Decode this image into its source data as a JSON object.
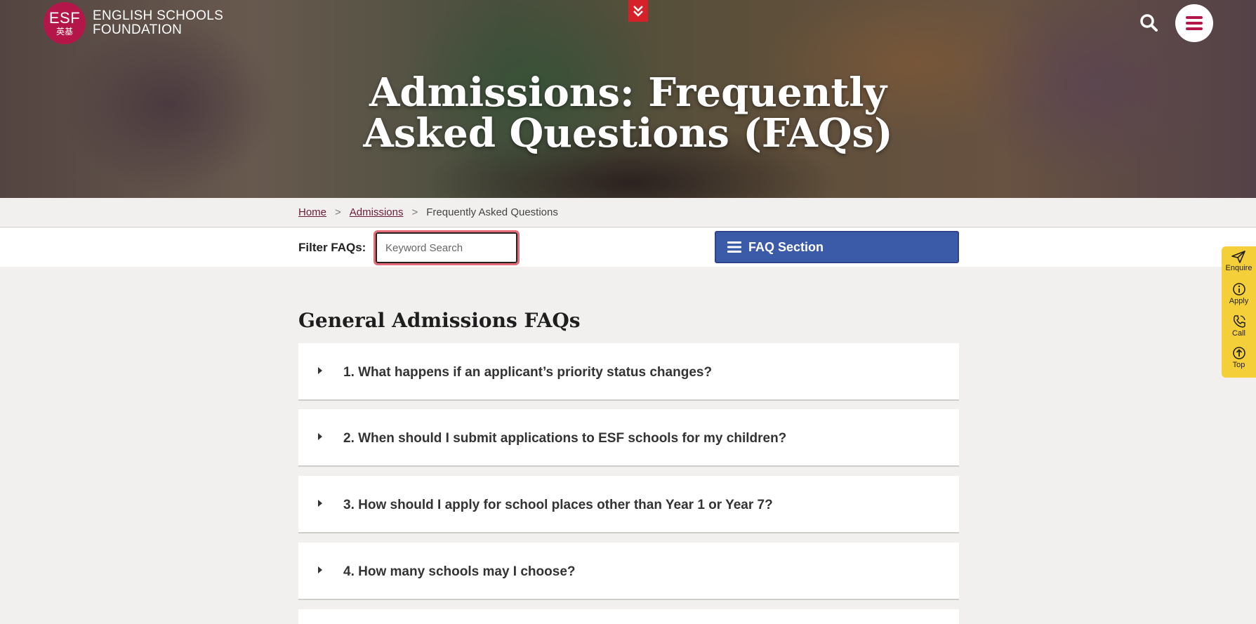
{
  "brand": {
    "badge_top": "ESF",
    "badge_bottom": "英基",
    "line1": "ENGLISH SCHOOLS",
    "line2": "FOUNDATION",
    "color": "#b5164a"
  },
  "hero": {
    "title_line1": "Admissions: Frequently",
    "title_line2": "Asked Questions (FAQs)"
  },
  "header": {
    "search_icon": "search-icon",
    "menu_icon": "hamburger-icon",
    "scroll_down_icon": "double-chevron-down-icon"
  },
  "breadcrumb": {
    "home": "Home",
    "sep": ">",
    "admissions": "Admissions",
    "current": "Frequently Asked Questions"
  },
  "filter": {
    "label": "Filter FAQs:",
    "placeholder": "Keyword Search",
    "value": "",
    "section_button": "FAQ Section",
    "section_button_color": "#3b5aa8"
  },
  "side_widget": {
    "color": "#f5cf3a",
    "items": [
      "Enquire",
      "Apply",
      "Call",
      "Top"
    ]
  },
  "section": {
    "title": "General Admissions FAQs",
    "questions": [
      "1. What happens if an applicant’s priority status changes?",
      "2. When should I submit applications to ESF schools for my children?",
      "3. How should I apply for school places other than Year 1 or Year 7?",
      "4. How many schools may I choose?"
    ]
  }
}
